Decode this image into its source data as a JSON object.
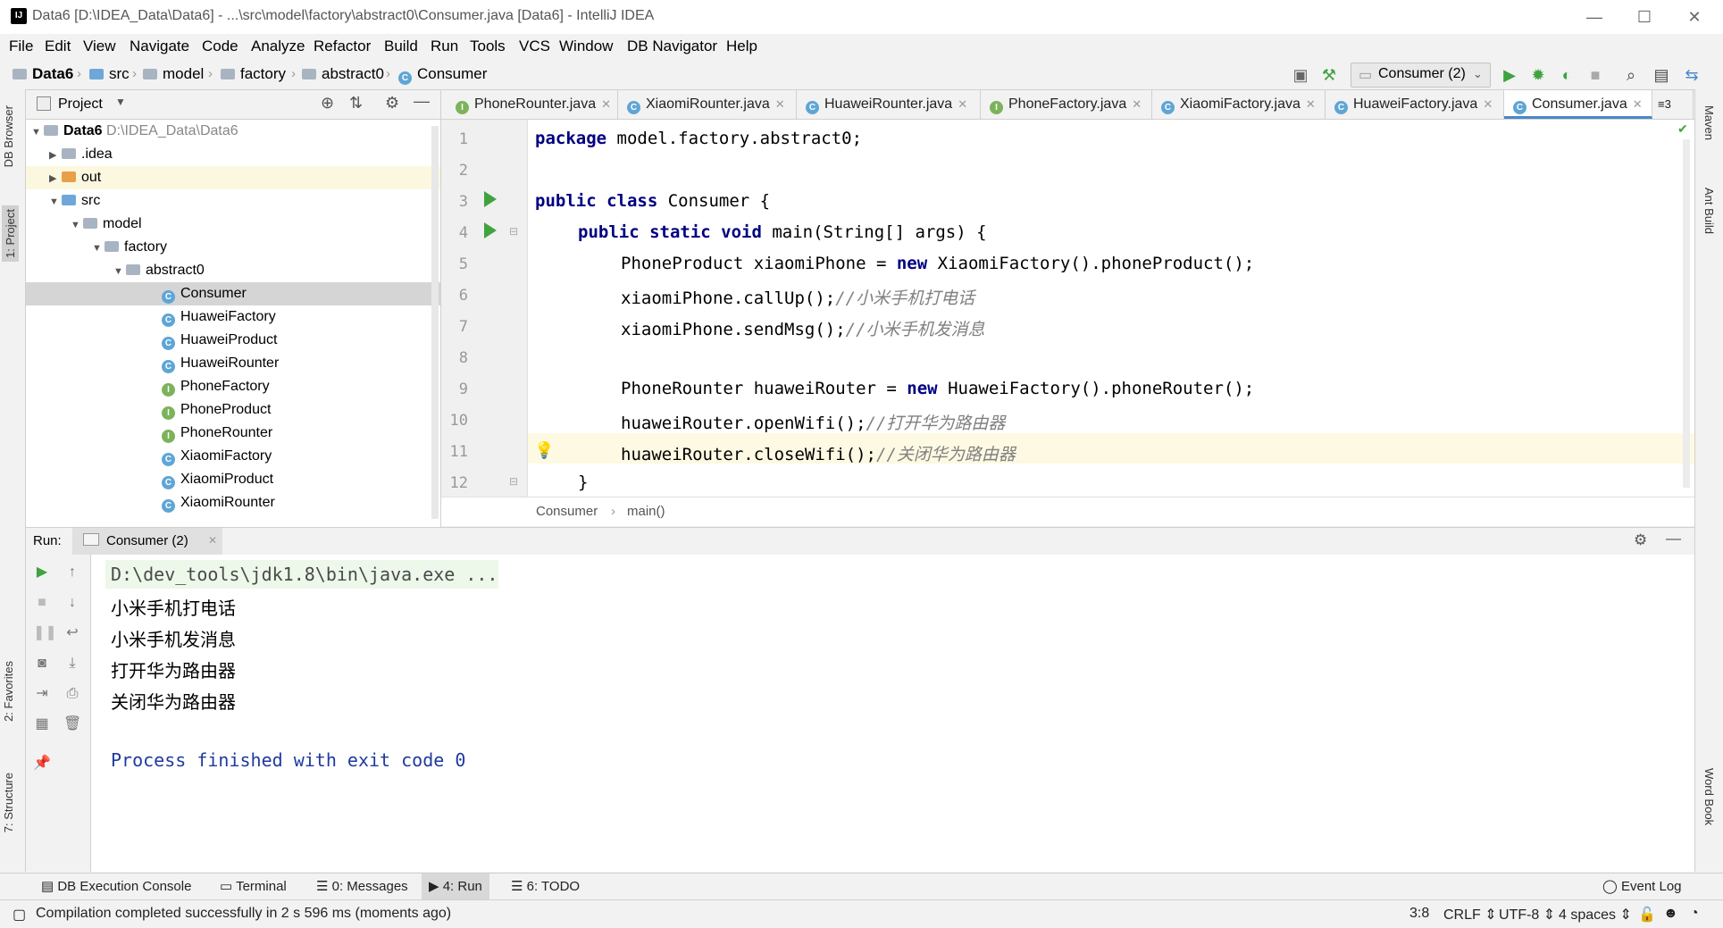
{
  "window": {
    "title": "Data6 [D:\\IDEA_Data\\Data6] - ...\\src\\model\\factory\\abstract0\\Consumer.java [Data6] - IntelliJ IDEA"
  },
  "menu": [
    "File",
    "Edit",
    "View",
    "Navigate",
    "Code",
    "Analyze",
    "Refactor",
    "Build",
    "Run",
    "Tools",
    "VCS",
    "Window",
    "DB Navigator",
    "Help"
  ],
  "breadcrumbs": [
    "Data6",
    "src",
    "model",
    "factory",
    "abstract0",
    "Consumer"
  ],
  "run_config": "Consumer (2)",
  "side_tabs_left": [
    "DB Browser",
    "1: Project",
    "2: Favorites",
    "7: Structure"
  ],
  "side_tabs_right": [
    "Maven",
    "Ant Build",
    "Word Book"
  ],
  "project": {
    "header": "Project",
    "root": {
      "name": "Data6",
      "path": "D:\\IDEA_Data\\Data6"
    },
    "items": [
      ".idea",
      "out",
      "src",
      "model",
      "factory",
      "abstract0",
      "Consumer",
      "HuaweiFactory",
      "HuaweiProduct",
      "HuaweiRounter",
      "PhoneFactory",
      "PhoneProduct",
      "PhoneRounter",
      "XiaomiFactory",
      "XiaomiProduct",
      "XiaomiRounter"
    ]
  },
  "tabs": [
    "PhoneRounter.java",
    "XiaomiRounter.java",
    "HuaweiRounter.java",
    "PhoneFactory.java",
    "XiaomiFactory.java",
    "HuaweiFactory.java",
    "Consumer.java"
  ],
  "tabs_overflow": "3",
  "editor": {
    "line_numbers": [
      "1",
      "2",
      "3",
      "4",
      "5",
      "6",
      "7",
      "8",
      "9",
      "10",
      "11",
      "12"
    ],
    "l1": {
      "kw": "package",
      "rest": " model.factory.abstract0;"
    },
    "l3": {
      "kw": "public class",
      "rest": " Consumer {"
    },
    "l4": {
      "kw": "public static void",
      "rest": " main(String[] args) {"
    },
    "l5": {
      "a": "PhoneProduct xiaomiPhone = ",
      "kw": "new",
      "b": " XiaomiFactory().phoneProduct();"
    },
    "l6": {
      "a": "xiaomiPhone.callUp();",
      "cm": "//小米手机打电话"
    },
    "l7": {
      "a": "xiaomiPhone.sendMsg();",
      "cm": "//小米手机发消息"
    },
    "l9": {
      "a": "PhoneRounter huaweiRouter = ",
      "kw": "new",
      "b": " HuaweiFactory().phoneRouter();"
    },
    "l10": {
      "a": "huaweiRouter.openWifi();",
      "cm": "//打开华为路由器"
    },
    "l11": {
      "a": "huaweiRouter.closeWifi();",
      "cm": "//关闭华为路由器"
    },
    "l12": "}"
  },
  "editor_breadcrumb": [
    "Consumer",
    "main()"
  ],
  "run": {
    "label": "Run:",
    "tab": "Consumer (2)",
    "output": [
      "D:\\dev_tools\\jdk1.8\\bin\\java.exe ...",
      "小米手机打电话",
      "小米手机发消息",
      "打开华为路由器",
      "关闭华为路由器",
      "Process finished with exit code 0"
    ]
  },
  "tool_windows": [
    "DB Execution Console",
    "Terminal",
    "0: Messages",
    "4: Run",
    "6: TODO"
  ],
  "event_log": "Event Log",
  "status": {
    "message": "Compilation completed successfully in 2 s 596 ms (moments ago)",
    "position": "3:8",
    "line_sep": "CRLF ⇕",
    "encoding": "UTF-8 ⇕",
    "indent": "4 spaces ⇕"
  },
  "colors": {
    "keyword": "#000080",
    "comment": "#808080",
    "run_green": "#3fa33f",
    "path_gray": "#888888"
  }
}
